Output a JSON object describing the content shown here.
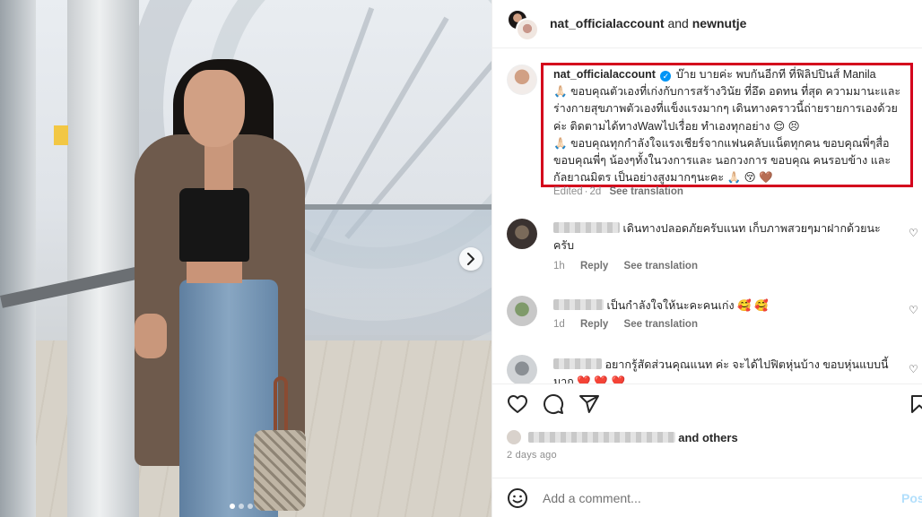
{
  "post": {
    "header": {
      "owner": "nat_officialaccount",
      "and_text": " and ",
      "collaborator": "newnutje"
    },
    "caption": {
      "username": "nat_officialaccount",
      "line1": "บ๊าย บายค่ะ พบกันอีกที ที่ฟิลิปปินส์ Manila",
      "line2": "ขอบคุณตัวเองที่เก่งกับการสร้างวินัย ที่อึด อดทน ที่สุด ความมานะและร่างกายสุขภาพตัวเองที่แข็งแรงมากๆ เดินทางคราวนี้ถ่ายรายการเองด้วยค่ะ ติดตามได้ทางWawไปเรื่อย ทำเองทุกอย่าง",
      "line3": "ขอบคุณทุกกำลังใจแรงเชียร์จากแฟนคลับแน็ตทุกคน ขอบคุณพี่ๆสื่อ ขอบคุณพี่ๆ น้องๆทั้งในวงการและ นอกวงการ ขอบคุณ คนรอบข้าง และกัลยาณมิตร เป็นอย่างสูงมากๆนะคะ",
      "meta_edited": "Edited",
      "meta_time": "2d",
      "see_translation": "See translation"
    },
    "comments": [
      {
        "text": "เดินทางปลอดภัยครับแนท เก็บภาพสวยๆมาฝากด้วยนะครับ",
        "time": "1h",
        "reply": "Reply",
        "see_translation": "See translation"
      },
      {
        "text": "เป็นกำลังใจให้นะคะคนเก่ง",
        "time": "1d",
        "reply": "Reply",
        "see_translation": "See translation"
      },
      {
        "text": "อยากรู้สัดส่วนคุณแนท ค่ะ จะได้ไปฟิตหุ่นบ้าง ขอบหุ่นแบบนี้มาก"
      }
    ],
    "likes": {
      "others": "and others"
    },
    "date": "2 days ago",
    "add_comment": {
      "placeholder": "Add a comment...",
      "post_label": "Post"
    }
  },
  "icons": {
    "verified": "verified-badge-icon",
    "like": "heart-icon",
    "comment": "comment-icon",
    "share": "share-icon",
    "save": "bookmark-icon",
    "emoji": "emoji-icon",
    "next": "chevron-right-icon"
  },
  "colors": {
    "highlight_box": "#d4001c",
    "verified": "#0095f6",
    "post_button": "#b2dffc"
  }
}
